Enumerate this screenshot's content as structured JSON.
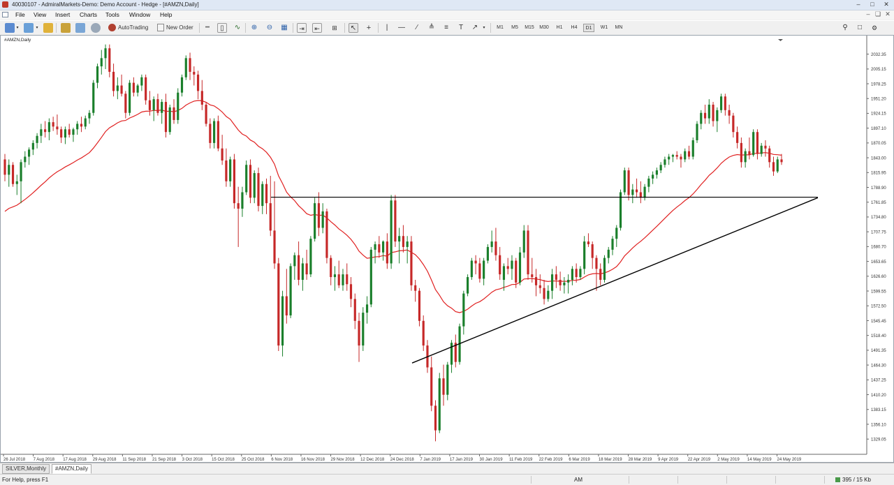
{
  "window": {
    "title": "40030107 - AdmiralMarkets-Demo: Demo Account - Hedge - [#AMZN,Daily]"
  },
  "menu": [
    "File",
    "View",
    "Insert",
    "Charts",
    "Tools",
    "Window",
    "Help"
  ],
  "toolbar": {
    "autotrading_label": "AutoTrading",
    "new_order_label": "New Order",
    "timeframes": [
      "M1",
      "M5",
      "M15",
      "M30",
      "H1",
      "H4",
      "D1",
      "W1",
      "MN"
    ],
    "active_timeframe": "D1"
  },
  "chart": {
    "label": "#AMZN,Daily"
  },
  "chart_data": {
    "type": "candlestick",
    "symbol": "#AMZN",
    "timeframe": "Daily",
    "ylim": [
      1314,
      2056
    ],
    "y_ticks": [
      "2032.35",
      "2005.15",
      "1978.25",
      "1951.20",
      "1924.15",
      "1897.10",
      "1870.05",
      "1843.00",
      "1815.95",
      "1788.90",
      "1761.85",
      "1734.80",
      "1707.75",
      "1680.70",
      "1653.65",
      "1626.60",
      "1599.55",
      "1572.50",
      "1545.45",
      "1518.40",
      "1491.35",
      "1464.30",
      "1437.25",
      "1410.20",
      "1383.15",
      "1356.10",
      "1329.05"
    ],
    "x_ticks": [
      "26 Jul 2018",
      "7 Aug 2018",
      "17 Aug 2018",
      "29 Aug 2018",
      "11 Sep 2018",
      "21 Sep 2018",
      "3 Oct 2018",
      "15 Oct 2018",
      "25 Oct 2018",
      "6 Nov 2018",
      "16 Nov 2018",
      "29 Nov 2018",
      "12 Dec 2018",
      "24 Dec 2018",
      "7 Jan 2019",
      "17 Jan 2019",
      "30 Jan 2019",
      "11 Feb 2019",
      "22 Feb 2019",
      "6 Mar 2019",
      "18 Mar 2019",
      "28 Mar 2019",
      "9 Apr 2019",
      "22 Apr 2019",
      "2 May 2019",
      "14 May 2019",
      "24 May 2019"
    ],
    "ohlc": [
      [
        1840,
        1850,
        1800,
        1812
      ],
      [
        1812,
        1840,
        1790,
        1830
      ],
      [
        1830,
        1835,
        1790,
        1795
      ],
      [
        1795,
        1812,
        1775,
        1800
      ],
      [
        1800,
        1840,
        1760,
        1835
      ],
      [
        1835,
        1855,
        1825,
        1845
      ],
      [
        1845,
        1862,
        1830,
        1858
      ],
      [
        1858,
        1875,
        1848,
        1870
      ],
      [
        1870,
        1888,
        1860,
        1883
      ],
      [
        1883,
        1905,
        1870,
        1895
      ],
      [
        1895,
        1910,
        1880,
        1890
      ],
      [
        1890,
        1915,
        1875,
        1908
      ],
      [
        1908,
        1918,
        1892,
        1900
      ],
      [
        1900,
        1922,
        1885,
        1895
      ],
      [
        1895,
        1900,
        1870,
        1880
      ],
      [
        1880,
        1900,
        1868,
        1895
      ],
      [
        1895,
        1905,
        1880,
        1885
      ],
      [
        1885,
        1898,
        1872,
        1895
      ],
      [
        1895,
        1910,
        1885,
        1905
      ],
      [
        1905,
        1918,
        1890,
        1900
      ],
      [
        1900,
        1920,
        1895,
        1915
      ],
      [
        1915,
        1930,
        1905,
        1925
      ],
      [
        1925,
        1985,
        1920,
        1980
      ],
      [
        1980,
        2015,
        1970,
        2010
      ],
      [
        2010,
        2040,
        1995,
        2025
      ],
      [
        2025,
        2050,
        2005,
        2043
      ],
      [
        2043,
        2050,
        1990,
        2000
      ],
      [
        2000,
        2015,
        1955,
        1965
      ],
      [
        1965,
        1990,
        1950,
        1975
      ],
      [
        1975,
        1995,
        1955,
        1960
      ],
      [
        1960,
        1965,
        1915,
        1925
      ],
      [
        1925,
        1985,
        1920,
        1980
      ],
      [
        1980,
        1990,
        1955,
        1962
      ],
      [
        1962,
        1978,
        1955,
        1975
      ],
      [
        1975,
        1995,
        1965,
        1990
      ],
      [
        1990,
        1995,
        1940,
        1948
      ],
      [
        1948,
        1965,
        1920,
        1930
      ],
      [
        1930,
        1955,
        1910,
        1950
      ],
      [
        1950,
        1960,
        1920,
        1925
      ],
      [
        1925,
        1950,
        1905,
        1945
      ],
      [
        1945,
        1960,
        1880,
        1890
      ],
      [
        1890,
        1940,
        1885,
        1935
      ],
      [
        1935,
        1950,
        1905,
        1912
      ],
      [
        1912,
        1970,
        1905,
        1962
      ],
      [
        1962,
        1995,
        1955,
        1990
      ],
      [
        1990,
        2030,
        1985,
        2025
      ],
      [
        2025,
        2035,
        1985,
        2000
      ],
      [
        2000,
        2010,
        1975,
        1995
      ],
      [
        1995,
        2002,
        1950,
        1965
      ],
      [
        1965,
        1985,
        1930,
        1940
      ],
      [
        1940,
        1945,
        1900,
        1905
      ],
      [
        1905,
        1915,
        1860,
        1870
      ],
      [
        1870,
        1915,
        1860,
        1910
      ],
      [
        1910,
        1920,
        1855,
        1860
      ],
      [
        1860,
        1885,
        1830,
        1838
      ],
      [
        1838,
        1860,
        1790,
        1800
      ],
      [
        1800,
        1845,
        1790,
        1840
      ],
      [
        1840,
        1850,
        1750,
        1760
      ],
      [
        1760,
        1790,
        1680,
        1750
      ],
      [
        1750,
        1790,
        1735,
        1780
      ],
      [
        1780,
        1838,
        1775,
        1830
      ],
      [
        1830,
        1840,
        1760,
        1770
      ],
      [
        1770,
        1820,
        1760,
        1815
      ],
      [
        1815,
        1825,
        1745,
        1755
      ],
      [
        1755,
        1800,
        1740,
        1795
      ],
      [
        1795,
        1805,
        1740,
        1760
      ],
      [
        1760,
        1810,
        1700,
        1710
      ],
      [
        1710,
        1800,
        1640,
        1650
      ],
      [
        1650,
        1660,
        1490,
        1500
      ],
      [
        1500,
        1600,
        1480,
        1590
      ],
      [
        1590,
        1640,
        1540,
        1555
      ],
      [
        1555,
        1650,
        1550,
        1645
      ],
      [
        1645,
        1670,
        1620,
        1665
      ],
      [
        1665,
        1690,
        1610,
        1620
      ],
      [
        1620,
        1660,
        1600,
        1650
      ],
      [
        1650,
        1675,
        1620,
        1630
      ],
      [
        1630,
        1700,
        1625,
        1695
      ],
      [
        1695,
        1770,
        1690,
        1760
      ],
      [
        1760,
        1780,
        1700,
        1715
      ],
      [
        1715,
        1760,
        1705,
        1745
      ],
      [
        1745,
        1750,
        1650,
        1660
      ],
      [
        1660,
        1665,
        1610,
        1625
      ],
      [
        1625,
        1645,
        1600,
        1630
      ],
      [
        1630,
        1655,
        1605,
        1610
      ],
      [
        1610,
        1640,
        1600,
        1630
      ],
      [
        1630,
        1650,
        1600,
        1612
      ],
      [
        1612,
        1625,
        1570,
        1585
      ],
      [
        1585,
        1595,
        1530,
        1545
      ],
      [
        1545,
        1560,
        1470,
        1500
      ],
      [
        1500,
        1570,
        1490,
        1560
      ],
      [
        1560,
        1590,
        1540,
        1575
      ],
      [
        1575,
        1680,
        1570,
        1675
      ],
      [
        1675,
        1690,
        1650,
        1685
      ],
      [
        1685,
        1700,
        1660,
        1670
      ],
      [
        1670,
        1692,
        1655,
        1690
      ],
      [
        1690,
        1705,
        1640,
        1650
      ],
      [
        1650,
        1775,
        1640,
        1765
      ],
      [
        1765,
        1775,
        1680,
        1690
      ],
      [
        1690,
        1715,
        1650,
        1700
      ],
      [
        1700,
        1720,
        1670,
        1680
      ],
      [
        1680,
        1700,
        1650,
        1690
      ],
      [
        1690,
        1700,
        1600,
        1610
      ],
      [
        1610,
        1620,
        1580,
        1600
      ],
      [
        1600,
        1605,
        1535,
        1545
      ],
      [
        1545,
        1555,
        1490,
        1500
      ],
      [
        1500,
        1510,
        1450,
        1460
      ],
      [
        1460,
        1480,
        1380,
        1390
      ],
      [
        1390,
        1400,
        1325,
        1345
      ],
      [
        1345,
        1450,
        1340,
        1440
      ],
      [
        1440,
        1465,
        1390,
        1410
      ],
      [
        1410,
        1470,
        1400,
        1465
      ],
      [
        1465,
        1510,
        1450,
        1505
      ],
      [
        1505,
        1520,
        1460,
        1470
      ],
      [
        1470,
        1540,
        1465,
        1535
      ],
      [
        1535,
        1600,
        1520,
        1595
      ],
      [
        1595,
        1630,
        1590,
        1625
      ],
      [
        1625,
        1660,
        1620,
        1655
      ],
      [
        1655,
        1665,
        1630,
        1650
      ],
      [
        1650,
        1660,
        1615,
        1622
      ],
      [
        1622,
        1660,
        1610,
        1655
      ],
      [
        1655,
        1685,
        1650,
        1680
      ],
      [
        1680,
        1710,
        1670,
        1690
      ],
      [
        1690,
        1715,
        1655,
        1665
      ],
      [
        1665,
        1680,
        1620,
        1630
      ],
      [
        1620,
        1650,
        1600,
        1645
      ],
      [
        1645,
        1660,
        1630,
        1640
      ],
      [
        1640,
        1665,
        1620,
        1655
      ],
      [
        1655,
        1660,
        1605,
        1615
      ],
      [
        1615,
        1680,
        1610,
        1670
      ],
      [
        1670,
        1720,
        1660,
        1710
      ],
      [
        1710,
        1720,
        1620,
        1630
      ],
      [
        1630,
        1660,
        1615,
        1625
      ],
      [
        1625,
        1640,
        1590,
        1610
      ],
      [
        1610,
        1630,
        1595,
        1605
      ],
      [
        1605,
        1620,
        1575,
        1585
      ],
      [
        1585,
        1610,
        1580,
        1600
      ],
      [
        1600,
        1640,
        1585,
        1630
      ],
      [
        1630,
        1645,
        1605,
        1620
      ],
      [
        1620,
        1635,
        1600,
        1610
      ],
      [
        1610,
        1625,
        1595,
        1615
      ],
      [
        1615,
        1630,
        1595,
        1620
      ],
      [
        1620,
        1645,
        1610,
        1640
      ],
      [
        1640,
        1650,
        1615,
        1625
      ],
      [
        1625,
        1645,
        1620,
        1640
      ],
      [
        1640,
        1700,
        1630,
        1690
      ],
      [
        1690,
        1705,
        1680,
        1685
      ],
      [
        1685,
        1690,
        1640,
        1660
      ],
      [
        1660,
        1665,
        1600,
        1640
      ],
      [
        1640,
        1650,
        1610,
        1620
      ],
      [
        1620,
        1665,
        1615,
        1660
      ],
      [
        1660,
        1680,
        1650,
        1675
      ],
      [
        1675,
        1700,
        1665,
        1695
      ],
      [
        1695,
        1720,
        1680,
        1715
      ],
      [
        1715,
        1785,
        1710,
        1780
      ],
      [
        1780,
        1825,
        1775,
        1820
      ],
      [
        1820,
        1825,
        1765,
        1775
      ],
      [
        1775,
        1795,
        1760,
        1785
      ],
      [
        1785,
        1805,
        1770,
        1780
      ],
      [
        1780,
        1800,
        1760,
        1770
      ],
      [
        1770,
        1795,
        1765,
        1790
      ],
      [
        1790,
        1810,
        1780,
        1805
      ],
      [
        1805,
        1818,
        1795,
        1812
      ],
      [
        1812,
        1825,
        1805,
        1820
      ],
      [
        1820,
        1835,
        1815,
        1830
      ],
      [
        1830,
        1845,
        1825,
        1840
      ],
      [
        1840,
        1850,
        1830,
        1845
      ],
      [
        1845,
        1850,
        1835,
        1848
      ],
      [
        1848,
        1855,
        1840,
        1845
      ],
      [
        1845,
        1850,
        1825,
        1840
      ],
      [
        1840,
        1860,
        1835,
        1855
      ],
      [
        1855,
        1865,
        1840,
        1845
      ],
      [
        1845,
        1880,
        1840,
        1875
      ],
      [
        1875,
        1910,
        1870,
        1905
      ],
      [
        1905,
        1930,
        1895,
        1925
      ],
      [
        1925,
        1940,
        1905,
        1915
      ],
      [
        1915,
        1950,
        1905,
        1940
      ],
      [
        1940,
        1945,
        1900,
        1910
      ],
      [
        1910,
        1935,
        1890,
        1930
      ],
      [
        1930,
        1960,
        1925,
        1955
      ],
      [
        1955,
        1960,
        1920,
        1930
      ],
      [
        1930,
        1940,
        1905,
        1920
      ],
      [
        1920,
        1925,
        1880,
        1890
      ],
      [
        1890,
        1900,
        1860,
        1870
      ],
      [
        1870,
        1880,
        1825,
        1835
      ],
      [
        1835,
        1860,
        1825,
        1855
      ],
      [
        1855,
        1880,
        1840,
        1848
      ],
      [
        1848,
        1895,
        1845,
        1890
      ],
      [
        1890,
        1895,
        1840,
        1850
      ],
      [
        1850,
        1870,
        1845,
        1865
      ],
      [
        1865,
        1875,
        1845,
        1860
      ],
      [
        1860,
        1865,
        1825,
        1835
      ],
      [
        1835,
        1845,
        1810,
        1818
      ],
      [
        1818,
        1845,
        1815,
        1840
      ],
      [
        1840,
        1850,
        1830,
        1835
      ]
    ],
    "ma": {
      "name": "MA",
      "color": "#e02020"
    },
    "levels": {
      "horizontal": 1771,
      "trendline_from": [
        1468,
        "2018-12-26"
      ],
      "trendline_to": [
        1770,
        "2019-05-30"
      ]
    },
    "colors": {
      "bull": "#1a7f2b",
      "bear": "#c62828",
      "ma": "#e02020",
      "line": "#000000"
    }
  },
  "tabs": [
    {
      "label": "SILVER,Monthly",
      "active": false
    },
    {
      "label": "#AMZN,Daily",
      "active": true
    }
  ],
  "status": {
    "help": "For Help, press F1",
    "mode": "AM",
    "traffic": "395 / 15 Kb"
  }
}
